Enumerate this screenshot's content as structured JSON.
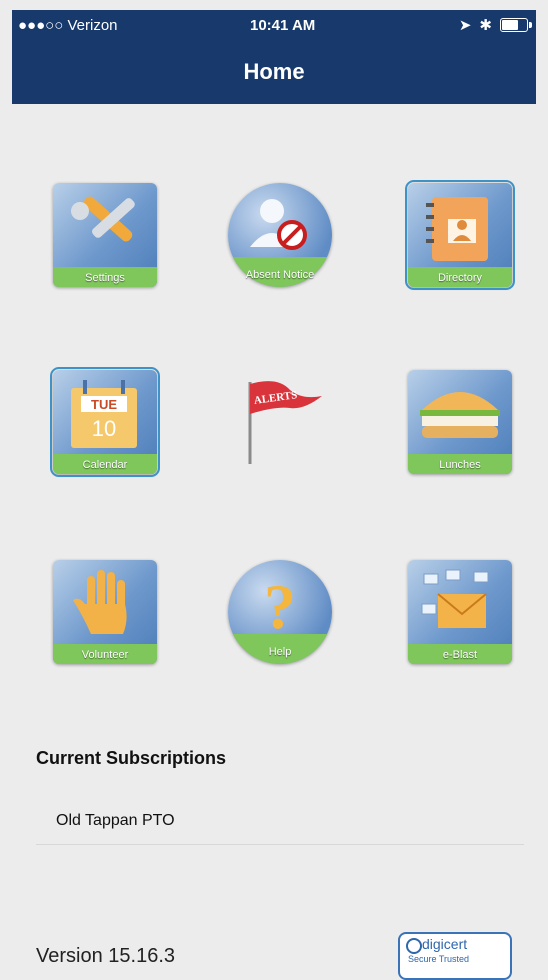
{
  "status": {
    "carrier": "●●●○○ Verizon",
    "time": "10:41 AM"
  },
  "header": {
    "title": "Home"
  },
  "tiles": [
    {
      "label": "Settings",
      "icon": "wrench-screwdriver-icon"
    },
    {
      "label": "Absent Notice",
      "icon": "absent-person-icon"
    },
    {
      "label": "Directory",
      "icon": "address-book-icon"
    },
    {
      "label": "Calendar",
      "icon": "calendar-icon",
      "day": "TUE",
      "date": "10"
    },
    {
      "label": "ALERTS",
      "icon": "alert-flag-icon"
    },
    {
      "label": "Lunches",
      "icon": "sandwich-icon"
    },
    {
      "label": "Volunteer",
      "icon": "raised-hand-icon"
    },
    {
      "label": "Help",
      "icon": "question-mark-icon"
    },
    {
      "label": "e-Blast",
      "icon": "envelopes-icon"
    }
  ],
  "subscriptions": {
    "title": "Current Subscriptions",
    "items": [
      "Old Tappan PTO"
    ]
  },
  "footer": {
    "version": "Version 15.16.3",
    "badge_name": "digicert",
    "badge_sub": "Secure  Trusted"
  },
  "colors": {
    "nav": "#17396b",
    "tile_band": "#7fc65b",
    "background": "#ececec"
  }
}
